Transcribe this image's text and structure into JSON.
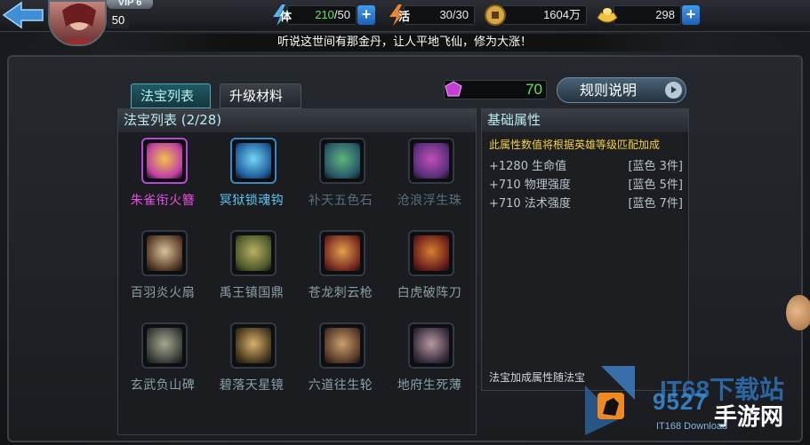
{
  "player": {
    "vip_label": "VIP 6",
    "level": "50"
  },
  "resources": {
    "stamina": {
      "label": "体",
      "current": "210",
      "max": "/50"
    },
    "vitality": {
      "label": "活",
      "value": "30/30"
    },
    "gold": {
      "value": "1604万"
    },
    "ingot": {
      "value": "298"
    }
  },
  "ticker": "听说这世间有那金丹，让人平地飞仙，修为大涨！",
  "tabs": [
    {
      "label": "法宝列表",
      "active": true
    },
    {
      "label": "升级材料",
      "active": false
    }
  ],
  "gem_count": "70",
  "rules_button": "规则说明",
  "list": {
    "title": "法宝列表 (2/28)",
    "items": [
      {
        "name": "朱雀衔火簪",
        "color": "#e84ee2",
        "art": [
          "#c03ea6",
          "#f0c24a"
        ]
      },
      {
        "name": "冥狱锁魂钩",
        "color": "#5fc6f2",
        "art": [
          "#1f5f9d",
          "#74d3f5"
        ]
      },
      {
        "name": "补天五色石",
        "color": "#56707a",
        "art": [
          "#28586a",
          "#5db47a"
        ]
      },
      {
        "name": "沧浪浮生珠",
        "color": "#56707a",
        "art": [
          "#5a2e7a",
          "#c24fb9"
        ]
      },
      {
        "name": "百羽炎火扇",
        "color": "#8aa0a8",
        "art": [
          "#5a3d2a",
          "#d9c29a"
        ]
      },
      {
        "name": "禹王镇国鼎",
        "color": "#8aa0a8",
        "art": [
          "#4d5a2a",
          "#b8b061"
        ]
      },
      {
        "name": "苍龙刺云枪",
        "color": "#8aa0a8",
        "art": [
          "#7a2a1f",
          "#e0a24d"
        ]
      },
      {
        "name": "白虎破阵刀",
        "color": "#8aa0a8",
        "art": [
          "#6a1f1a",
          "#d88030"
        ]
      },
      {
        "name": "玄武负山碑",
        "color": "#8aa0a8",
        "art": [
          "#3a3f3a",
          "#a8a890"
        ]
      },
      {
        "name": "碧落天星镜",
        "color": "#8aa0a8",
        "art": [
          "#4a3a20",
          "#d9b26a"
        ]
      },
      {
        "name": "六道往生轮",
        "color": "#8aa0a8",
        "art": [
          "#5a3a2a",
          "#caa06a"
        ]
      },
      {
        "name": "地府生死薄",
        "color": "#8aa0a8",
        "art": [
          "#3a3040",
          "#b89aa0"
        ]
      }
    ]
  },
  "attributes": {
    "title": "基础属性",
    "note": "此属性数值将根据英雄等级匹配加成",
    "rows": [
      {
        "stat": "+1280 生命值",
        "req": "[蓝色 3件]"
      },
      {
        "stat": "+710 物理强度",
        "req": "[蓝色 5件]"
      },
      {
        "stat": "+710 法术强度",
        "req": "[蓝色 7件]"
      }
    ],
    "footer": "法宝加成属性随法宝"
  },
  "watermark": {
    "top": "IT68下载站",
    "number": "9527",
    "cn": "手游网",
    "sub": "IT168 Download"
  },
  "colors": {
    "accent_teal": "#53a9b3",
    "gem_green": "#59e85a",
    "note_yellow": "#f2cf44",
    "purple_item": "#e84ee2",
    "blue_item": "#5fc6f2"
  }
}
